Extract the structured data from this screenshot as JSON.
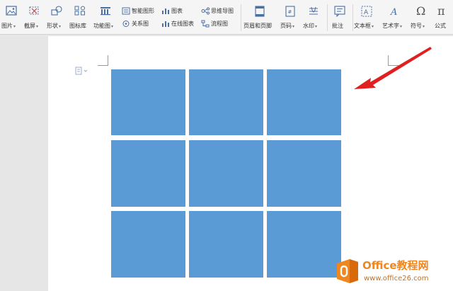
{
  "ribbon": {
    "picture": "图片",
    "screenshot": "截屏",
    "shape": "形状",
    "icon_lib": "图标库",
    "function_chart": "功能图",
    "smart_graphic": "智能图形",
    "chart": "图表",
    "mindmap": "思维导图",
    "relation": "关系图",
    "online_chart": "在线图表",
    "flowchart": "流程图",
    "header_footer": "页眉和页脚",
    "page_number": "页码",
    "watermark": "水印",
    "comment": "批注",
    "textbox": "文本框",
    "wordart": "艺术字",
    "symbol": "符号",
    "formula": "公式"
  },
  "grid": {
    "rows": 3,
    "cols": 3,
    "tile_color": "#5b9bd5"
  },
  "annotation_arrow_color": "#e02020",
  "brand": {
    "name": "Office教程网",
    "url": "www.office26.com",
    "accent": "#f0861e"
  }
}
